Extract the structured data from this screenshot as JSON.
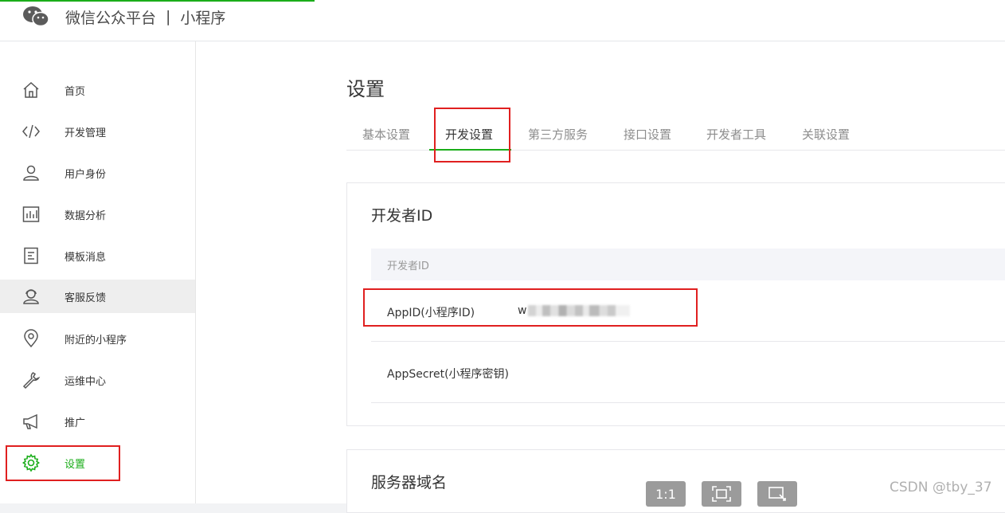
{
  "header": {
    "platform": "微信公众平台",
    "separator": "|",
    "product": "小程序"
  },
  "sidebar": {
    "items": [
      {
        "label": "首页",
        "icon": "home-icon"
      },
      {
        "label": "开发管理",
        "icon": "code-icon"
      },
      {
        "label": "用户身份",
        "icon": "user-icon"
      },
      {
        "label": "数据分析",
        "icon": "bar-chart-icon"
      },
      {
        "label": "模板消息",
        "icon": "document-icon"
      },
      {
        "label": "客服反馈",
        "icon": "customer-service-icon"
      },
      {
        "label": "附近的小程序",
        "icon": "location-pin-icon"
      },
      {
        "label": "运维中心",
        "icon": "wrench-icon"
      },
      {
        "label": "推广",
        "icon": "megaphone-icon"
      },
      {
        "label": "设置",
        "icon": "gear-icon"
      }
    ]
  },
  "main": {
    "title": "设置",
    "tabs": [
      {
        "label": "基本设置"
      },
      {
        "label": "开发设置"
      },
      {
        "label": "第三方服务"
      },
      {
        "label": "接口设置"
      },
      {
        "label": "开发者工具"
      },
      {
        "label": "关联设置"
      }
    ],
    "developer_id": {
      "title": "开发者ID",
      "table_header": "开发者ID",
      "rows": [
        {
          "label": "AppID(小程序ID)",
          "value": "w"
        },
        {
          "label": "AppSecret(小程序密钥)",
          "value": ""
        }
      ]
    },
    "server_domain": {
      "title": "服务器域名"
    }
  },
  "viewer": {
    "actual_size": "1:1"
  },
  "watermark": "CSDN @tby_37",
  "colors": {
    "accent": "#1aad19",
    "highlight": "#e02020"
  }
}
